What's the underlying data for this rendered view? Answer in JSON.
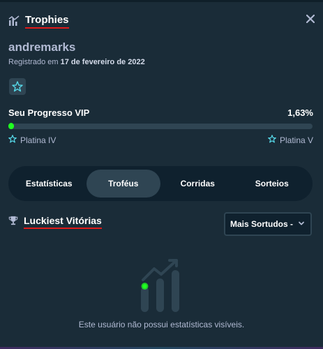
{
  "header": {
    "title": "Trophies",
    "icon": "chart-icon",
    "close_icon": "close-icon"
  },
  "profile": {
    "username": "andremarks",
    "registered_prefix": "Registrado em",
    "registered_date": "17 de fevereiro de 2022",
    "vip_icon": "star-badge-icon"
  },
  "vip": {
    "label": "Seu Progresso VIP",
    "percent_text": "1,63%",
    "progress_fraction": 0.0163,
    "current_tier": "Platina IV",
    "next_tier": "Platina V",
    "progress_color": "#1fff20"
  },
  "tabs": [
    {
      "label": "Estatísticas",
      "active": false
    },
    {
      "label": "Troféus",
      "active": true
    },
    {
      "label": "Corridas",
      "active": false
    },
    {
      "label": "Sorteios",
      "active": false
    }
  ],
  "section": {
    "title": "Luckiest Vitórias",
    "icon": "trophy-icon",
    "sort_select": "Mais Sortudos -"
  },
  "empty_state": {
    "message": "Este usuário não possui estatísticas visíveis.",
    "icon": "bar-chart-empty-icon"
  },
  "colors": {
    "background": "#1a2c38",
    "tab_bar": "#0f212e",
    "accent_green": "#1fff20",
    "underline_red": "#e01a1a"
  }
}
